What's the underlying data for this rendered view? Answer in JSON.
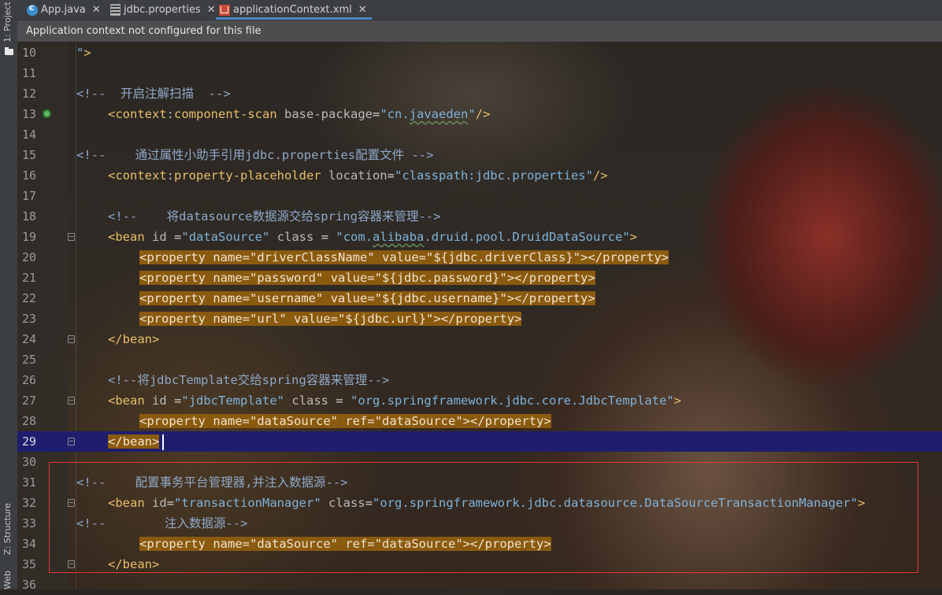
{
  "sidebar": {
    "project_label": "1: Project",
    "structure_label": "Z: Structure",
    "web_label": "Web"
  },
  "tabs": [
    {
      "label": "App.java",
      "icon": "java-class-icon",
      "active": false
    },
    {
      "label": "jdbc.properties",
      "icon": "properties-file-icon",
      "active": false
    },
    {
      "label": "applicationContext.xml",
      "icon": "xml-file-icon",
      "active": true
    }
  ],
  "tab_close_glyph": "✕",
  "banner": {
    "text": "Application context not configured for this file"
  },
  "editor": {
    "current_line": 29,
    "lines": [
      {
        "n": "10",
        "text": "\">"
      },
      {
        "n": "11",
        "text": ""
      },
      {
        "n": "12",
        "text": "<!--  开启注解扫描  -->"
      },
      {
        "n": "13",
        "text": "<context:component-scan base-package=\"cn.javaeden\"/>"
      },
      {
        "n": "14",
        "text": ""
      },
      {
        "n": "15",
        "text": "<!--    通过属性小助手引用jdbc.properties配置文件 -->"
      },
      {
        "n": "16",
        "text": "<context:property-placeholder location=\"classpath:jdbc.properties\"/>"
      },
      {
        "n": "17",
        "text": ""
      },
      {
        "n": "18",
        "text": "<!--    将datasource数据源交给spring容器来管理-->"
      },
      {
        "n": "19",
        "text": "<bean id =\"dataSource\" class = \"com.alibaba.druid.pool.DruidDataSource\">"
      },
      {
        "n": "20",
        "text": "<property name=\"driverClassName\" value=\"${jdbc.driverClass}\"></property>"
      },
      {
        "n": "21",
        "text": "<property name=\"password\" value=\"${jdbc.password}\"></property>"
      },
      {
        "n": "22",
        "text": "<property name=\"username\" value=\"${jdbc.username}\"></property>"
      },
      {
        "n": "23",
        "text": "<property name=\"url\" value=\"${jdbc.url}\"></property>"
      },
      {
        "n": "24",
        "text": "</bean>"
      },
      {
        "n": "25",
        "text": ""
      },
      {
        "n": "26",
        "text": "<!--将jdbcTemplate交给spring容器来管理-->"
      },
      {
        "n": "27",
        "text": "<bean id =\"jdbcTemplate\" class = \"org.springframework.jdbc.core.JdbcTemplate\">"
      },
      {
        "n": "28",
        "text": "<property name=\"dataSource\" ref=\"dataSource\"></property>"
      },
      {
        "n": "29",
        "text": "</bean>"
      },
      {
        "n": "30",
        "text": ""
      },
      {
        "n": "31",
        "text": "<!--    配置事务平台管理器,并注入数据源-->"
      },
      {
        "n": "32",
        "text": "<bean id=\"transactionManager\" class=\"org.springframework.jdbc.datasource.DataSourceTransactionManager\">"
      },
      {
        "n": "33",
        "text": "<!--        注入数据源-->"
      },
      {
        "n": "34",
        "text": "<property name=\"dataSource\" ref=\"dataSource\"></property>"
      },
      {
        "n": "35",
        "text": "</bean>"
      },
      {
        "n": "36",
        "text": ""
      }
    ]
  },
  "colors": {
    "tag": "#e8bf6a",
    "attribute": "#bababa",
    "value": "#7fb2d8",
    "comment": "#8fa8c8",
    "highlight": "#8a5a0f",
    "current_line": "#1f1e6e",
    "annotation_box": "#e23636"
  }
}
